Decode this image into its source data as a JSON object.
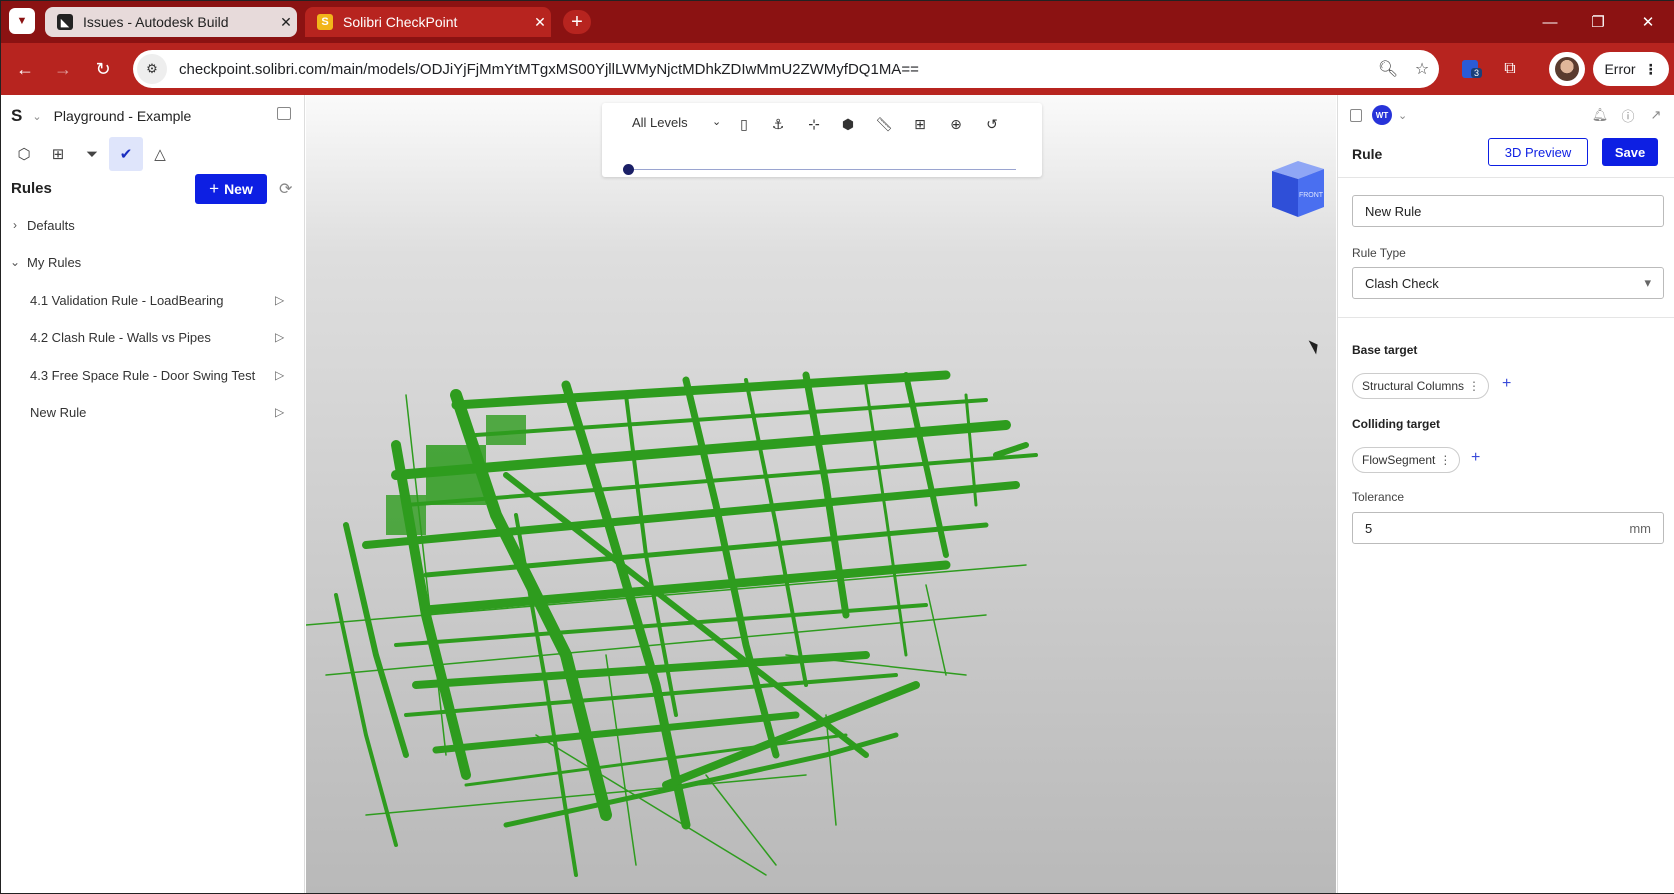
{
  "browser": {
    "tabs": [
      {
        "title": "Issues - Autodesk Build",
        "favicon": "autodesk-icon",
        "active": false
      },
      {
        "title": "Solibri CheckPoint",
        "favicon": "solibri-icon",
        "active": true
      }
    ],
    "url": "checkpoint.solibri.com/main/models/ODJiYjFjMmYtMTgxMS00YjllLWMyNjctMDhkZDIwMmU2ZWMyfDQ1MA==",
    "extension_badge": "3",
    "error_label": "Error",
    "colors": {
      "titlebar": "#8b1212",
      "toolbar": "#b7241f"
    }
  },
  "left_panel": {
    "logo": "S",
    "project": "Playground - Example",
    "rules_title": "Rules",
    "new_button": "New",
    "tree": [
      {
        "label": "Defaults",
        "expanded": false
      },
      {
        "label": "My Rules",
        "expanded": true
      }
    ],
    "rules": [
      {
        "label": "4.1 Validation Rule - LoadBearing"
      },
      {
        "label": "4.2 Clash Rule - Walls vs Pipes"
      },
      {
        "label": "4.3 Free Space Rule - Door Swing Test"
      },
      {
        "label": "New Rule"
      }
    ]
  },
  "viewer": {
    "levels": "All Levels",
    "navcube_label": "FRONT",
    "model_color": "#2e9c1e"
  },
  "right_panel": {
    "avatar_initials": "WT",
    "header": "Rule",
    "preview_button": "3D Preview",
    "save_button": "Save",
    "name_value": "New Rule",
    "rule_type_label": "Rule Type",
    "rule_type_value": "Clash Check",
    "base_target_label": "Base target",
    "base_target_chip": "Structural Columns",
    "colliding_target_label": "Colliding target",
    "colliding_target_chip": "FlowSegment",
    "tolerance_label": "Tolerance",
    "tolerance_value": "5",
    "tolerance_unit": "mm",
    "accent": "#0d1fe3"
  }
}
